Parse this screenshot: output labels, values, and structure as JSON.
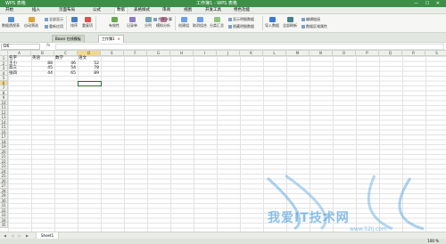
{
  "titlebar": {
    "app_name": "WPS 表格",
    "doc_title": "工作簿1 - WPS 表格",
    "window_buttons": "— ☐ ✕"
  },
  "menu": [
    "开始",
    "插入",
    "页面布局",
    "公式",
    "数据",
    "表格样式",
    "审阅",
    "视图",
    "开发工具",
    "特色功能"
  ],
  "ribbon": {
    "large_buttons": [
      "数据透视表",
      "自动筛选",
      "排序",
      "重复项",
      "有效性",
      "记录单",
      "分列",
      "模拟分析",
      "创建组",
      "取消组合",
      "分类汇总",
      "导入数据",
      "全部刷新"
    ],
    "small_buttons": [
      "全部显示",
      "重新应用",
      "合并计算",
      "显示明细数据",
      "隐藏明细数据",
      "编辑链接",
      "数据区域属性"
    ],
    "accent_color": "#3d8f48"
  },
  "tabs": [
    {
      "label": "Boxer 在线模板",
      "active": false
    },
    {
      "label": "工作簿1",
      "active": true
    }
  ],
  "formula_bar": {
    "cell_ref": "D6",
    "fx": "fx",
    "value": ""
  },
  "columns": [
    "A",
    "B",
    "C",
    "D",
    "E",
    "F",
    "G",
    "H",
    "I",
    "J",
    "K",
    "L",
    "M",
    "N",
    "O",
    "P",
    "Q",
    "R",
    "S"
  ],
  "rows": [
    "1",
    "2",
    "3",
    "4",
    "5",
    "6",
    "7",
    "8",
    "9",
    "10",
    "11",
    "12",
    "13",
    "14",
    "15",
    "16",
    "17",
    "18",
    "19",
    "20",
    "21",
    "22",
    "23",
    "24",
    "25",
    "26",
    "27",
    "28",
    "29",
    "30",
    "31",
    "32",
    "33",
    "34",
    "35"
  ],
  "table": {
    "headers": [
      "名字",
      "英语",
      "数学",
      "语文"
    ],
    "data": [
      [
        "王小",
        "88",
        "46",
        "52"
      ],
      [
        "高三",
        "45",
        "54",
        "78"
      ],
      [
        "张四",
        "44",
        "65",
        "89"
      ]
    ]
  },
  "selected_cell": "D6",
  "sheet": {
    "nav": "◀ ◁ ▷ ▶",
    "name": "Sheet1"
  },
  "status": {
    "zoom": "100 %"
  },
  "watermark": {
    "text": "我爱IT技术网",
    "url": "www.52ij.com"
  }
}
